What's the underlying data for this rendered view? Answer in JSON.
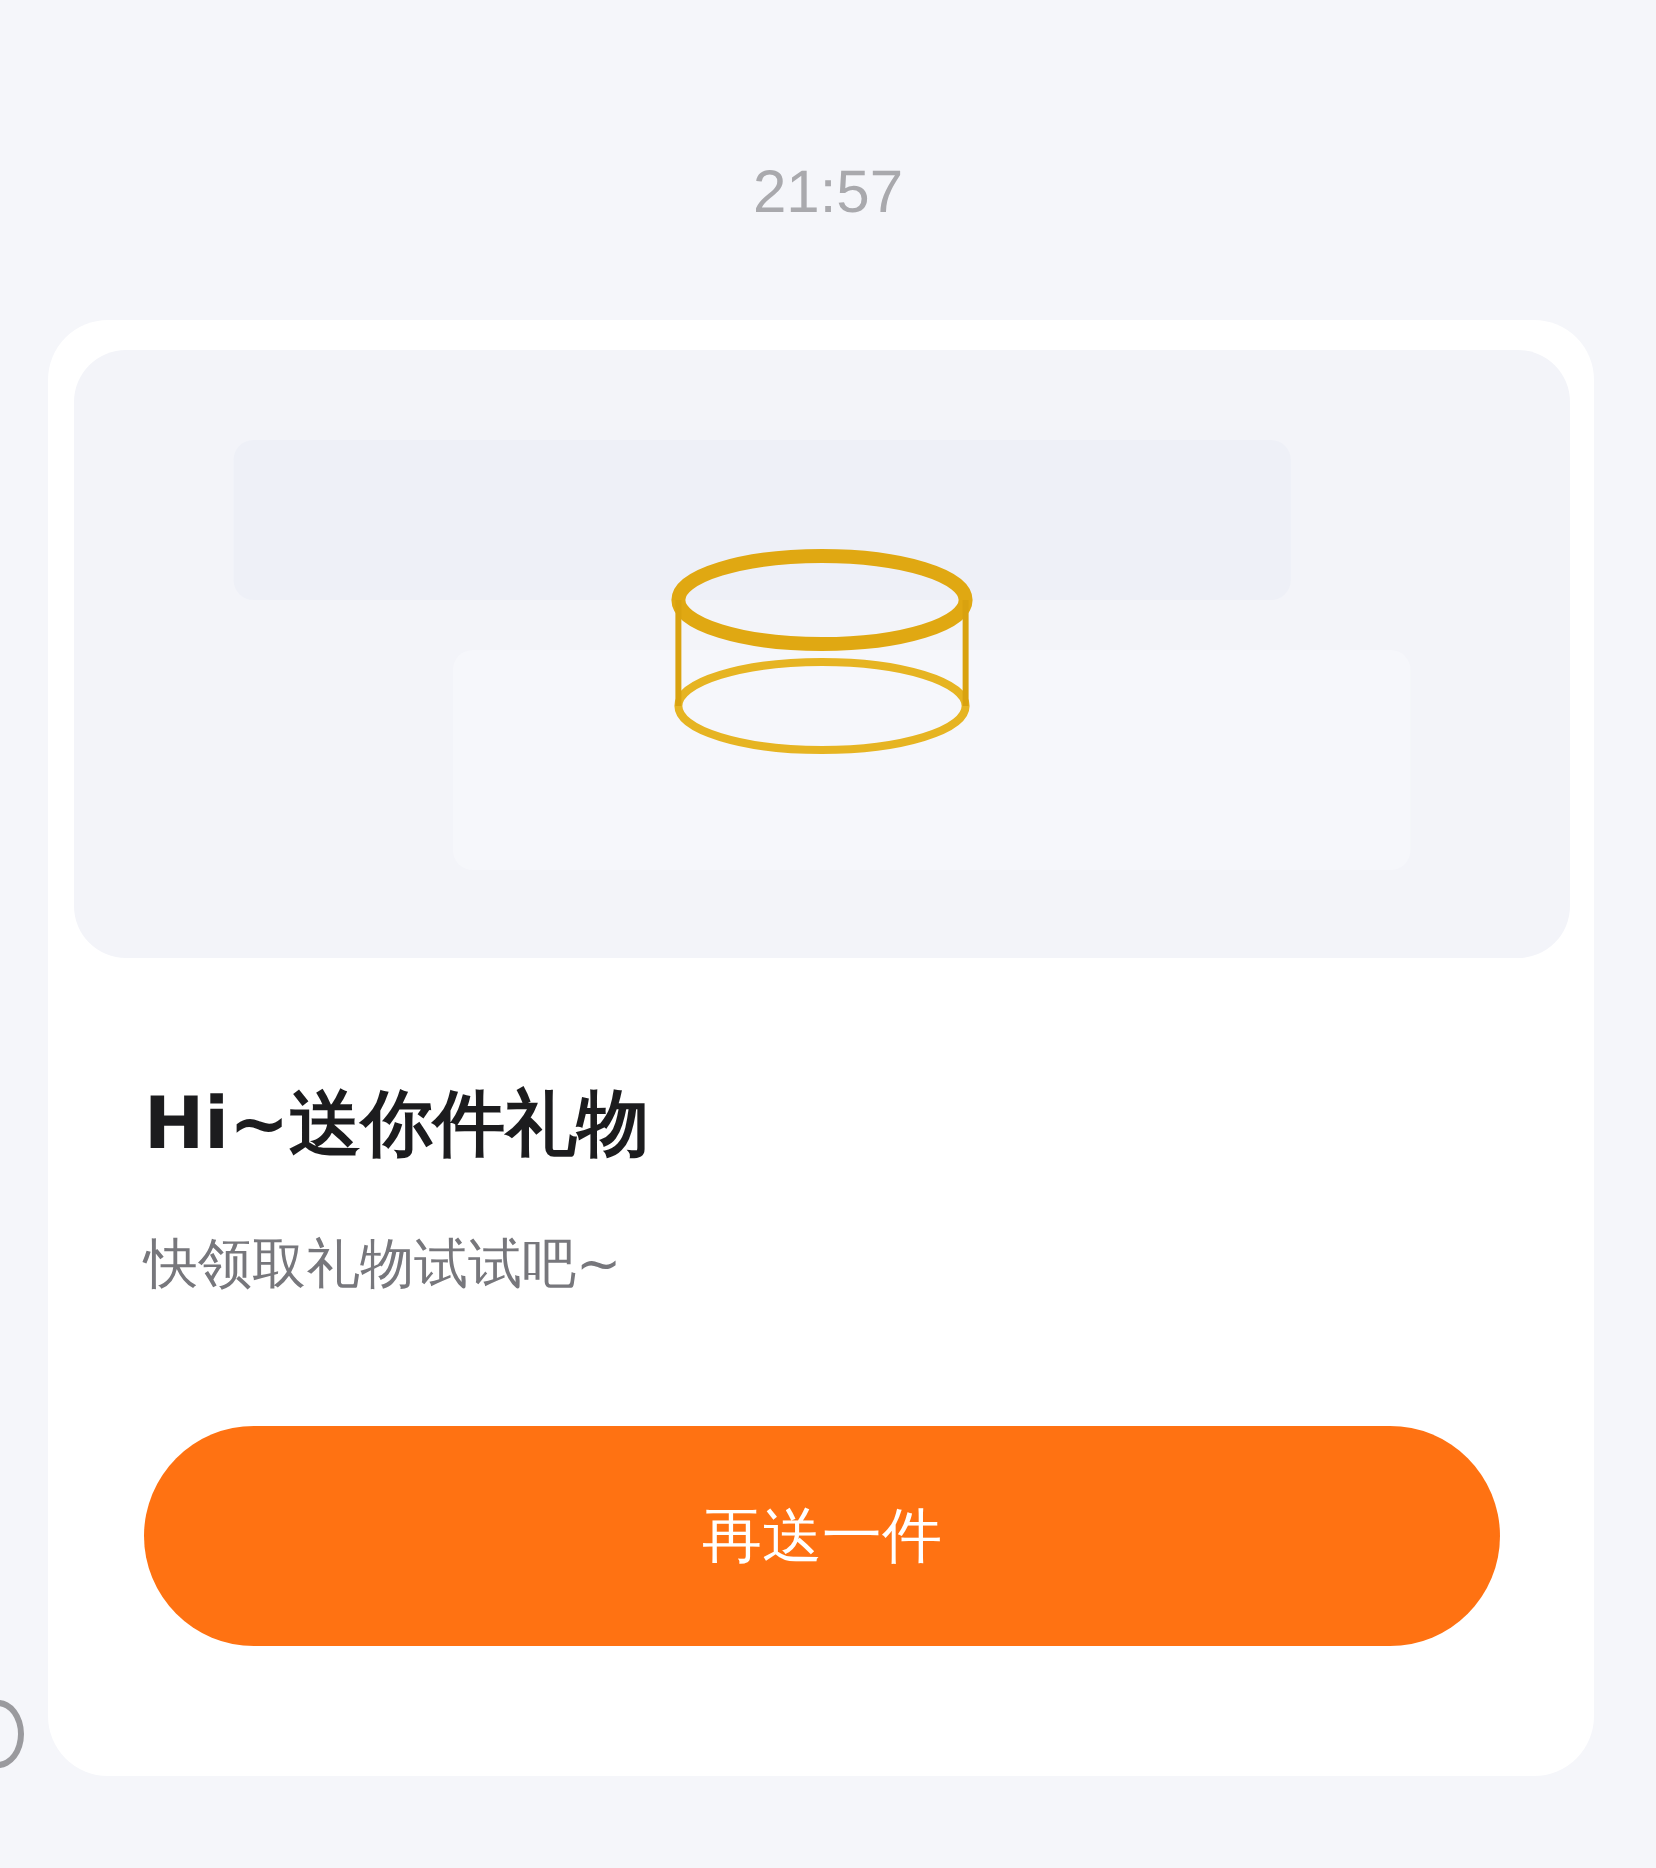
{
  "time": "21:57",
  "card": {
    "title": "Hi~送你件礼物",
    "subtitle": "快领取礼物试试吧~",
    "button": "再送一件"
  }
}
